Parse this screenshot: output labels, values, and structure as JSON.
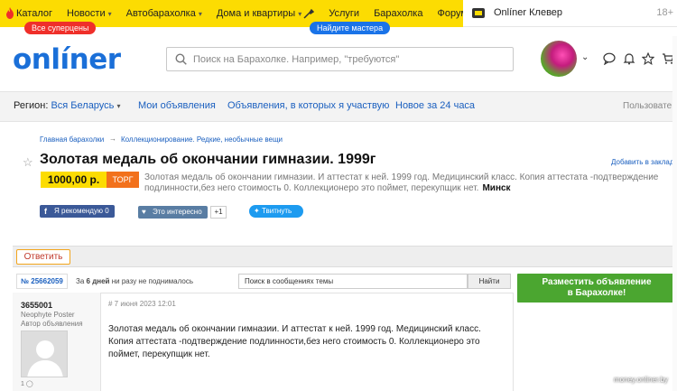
{
  "topnav": {
    "items": [
      "Каталог",
      "Новости",
      "Автобарахолка",
      "Дома и квартиры",
      "Услуги",
      "Барахолка",
      "Форум"
    ],
    "catalog_badge": "Все суперцены",
    "services_badge": "Найдите мастера",
    "clever": "Onlíner Клевер",
    "age": "18+"
  },
  "header": {
    "logo": "onlíner",
    "search_placeholder": "Поиск на Барахолке. Например, \"требуются\""
  },
  "subnav": {
    "region_label": "Регион:",
    "region_value": "Вся Беларусь",
    "links": [
      "Мои объявления",
      "Объявления, в которых я участвую",
      "Новое за 24 часа"
    ],
    "users": "Пользовате"
  },
  "breadcrumb": {
    "home": "Главная барахолки",
    "section": "Коллекционирование. Редкие, необычные вещи"
  },
  "ad": {
    "title": "Золотая медаль об окончании гимназии. 1999г",
    "bookmark": "Добавить в закладк",
    "price": "1000,00 р.",
    "torg": "ТОРГ",
    "summary": "Золотая медаль об окончании гимназии. И аттестат к ней. 1999 год. Медицинский класс. Копия аттестата -подтверждение подлинности,без него стоимость 0. Коллекционеро это поймет, перекупщик нет.",
    "city": "Минск"
  },
  "social": {
    "fb_label": "Я рекомендую",
    "fb_count": "0",
    "vk_label": "Это интересно",
    "vk_count": "+1",
    "tw_label": "Твитнуть"
  },
  "thread": {
    "reply": "Ответить",
    "id": "№ 25662059",
    "note_bold": "6 дней",
    "note_prefix": "За",
    "note_suffix": "ни разу не поднималось",
    "search_placeholder": "Поиск в сообщениях темы",
    "find": "Найти"
  },
  "place_ad": {
    "line1": "Разместить объявление",
    "line2": "в Барахолке!"
  },
  "post": {
    "user": "3655001",
    "rank1": "Neophyte Poster",
    "rank2": "Автор объявления",
    "stat": "1",
    "date": "# 7 июня 2023 12:01",
    "text": "Золотая медаль об окончании гимназии. И аттестат к ней. 1999 год. Медицинский класс. Копия аттестата -подтверждение подлинности,без него стоимость 0. Коллекционеро это поймет, перекупщик нет."
  },
  "watermark": "money.onliner.by",
  "colors": {
    "brand_yellow": "#fcdc02",
    "brand_blue": "#1a6fd8",
    "price_bg": "#fcdc02",
    "torg_bg": "#f2711c",
    "cta_green": "#4ba630"
  }
}
